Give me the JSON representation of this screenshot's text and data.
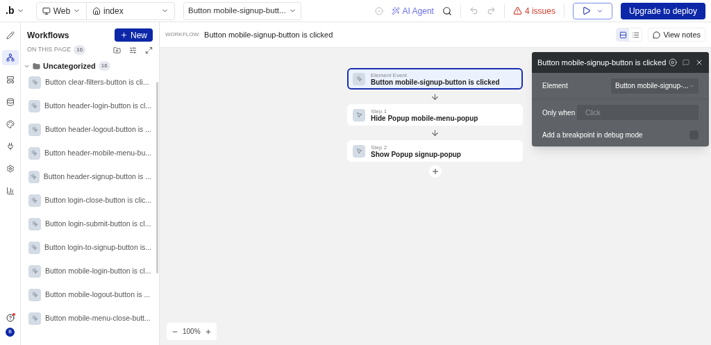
{
  "topbar": {
    "logo": ".b",
    "platform": "Web",
    "page": "index",
    "workflow_select": "Button mobile-signup-butt...",
    "ai_agent": "AI Agent",
    "issues": "4 issues",
    "deploy": "Upgrade to deploy"
  },
  "rail": {
    "items": [
      {
        "kind": "design",
        "selected": false
      },
      {
        "kind": "workflow",
        "selected": true
      },
      {
        "kind": "layout",
        "selected": false
      },
      {
        "kind": "data",
        "selected": false
      },
      {
        "kind": "styles",
        "selected": false
      },
      {
        "kind": "plugins",
        "selected": false
      },
      {
        "kind": "settings",
        "selected": false
      },
      {
        "kind": "logs",
        "selected": false
      }
    ],
    "avatar": "B"
  },
  "sidebar": {
    "title": "Workflows",
    "new_button": "New",
    "section": "ON THIS PAGE",
    "section_count": "16",
    "folder": {
      "name": "Uncategorized",
      "count": "16",
      "expanded": true
    },
    "items": [
      {
        "label": "Button clear-filters-button is cli..."
      },
      {
        "label": "Button header-login-button is cl..."
      },
      {
        "label": "Button header-logout-button is ..."
      },
      {
        "label": "Button header-mobile-menu-bu..."
      },
      {
        "label": "Button header-signup-button is ..."
      },
      {
        "label": "Button login-close-button is clic..."
      },
      {
        "label": "Button login-submit-button is cl..."
      },
      {
        "label": "Button login-to-signup-button is..."
      },
      {
        "label": "Button mobile-login-button is cl..."
      },
      {
        "label": "Button mobile-logout-button is ..."
      },
      {
        "label": "Button mobile-menu-close-butt..."
      }
    ]
  },
  "header": {
    "label": "WORKFLOW:",
    "title": "Button mobile-signup-button is clicked",
    "view_notes": "View notes",
    "views": [
      {
        "kind": "cards",
        "selected": true
      },
      {
        "kind": "list",
        "selected": false
      }
    ]
  },
  "canvas": {
    "steps": [
      {
        "kind": "event",
        "caption": "Element Event",
        "title": "Button mobile-signup-button is clicked",
        "selected": true
      },
      {
        "kind": "action",
        "caption": "Step 1",
        "title": "Hide Popup mobile-menu-popup",
        "selected": false
      },
      {
        "kind": "action",
        "caption": "Step 2",
        "title": "Show Popup signup-popup",
        "selected": false
      }
    ],
    "zoom": "100%"
  },
  "inspector": {
    "title": "Button mobile-signup-button is clicked",
    "element_label": "Element",
    "element_value": "Button mobile-signup-...",
    "only_when_label": "Only when",
    "only_when_placeholder": "Click",
    "breakpoint_label": "Add a breakpoint in debug mode",
    "breakpoint_checked": false
  }
}
